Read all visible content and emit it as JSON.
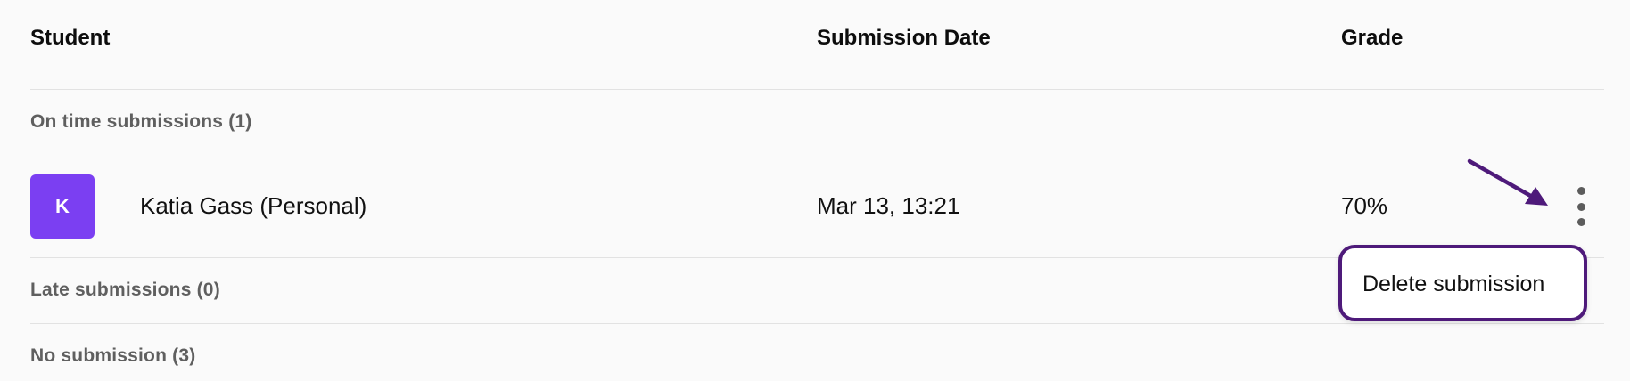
{
  "table": {
    "columns": {
      "student": "Student",
      "submission_date": "Submission Date",
      "grade": "Grade"
    }
  },
  "sections": {
    "on_time": "On time submissions (1)",
    "late": "Late submissions (0)",
    "no_submission": "No submission (3)"
  },
  "submissions": [
    {
      "avatar_initial": "K",
      "avatar_color": "#7b3ff2",
      "name": "Katia Gass (Personal)",
      "date": "Mar 13, 13:21",
      "grade": "70%"
    }
  ],
  "context_menu": {
    "delete_label": "Delete submission"
  },
  "icons": {
    "row_menu": "more-vertical-icon",
    "annotation": "arrow-icon"
  },
  "colors": {
    "accent": "#7b3ff2",
    "annotation": "#4e1a7a",
    "section_label": "#5f5f5f"
  }
}
